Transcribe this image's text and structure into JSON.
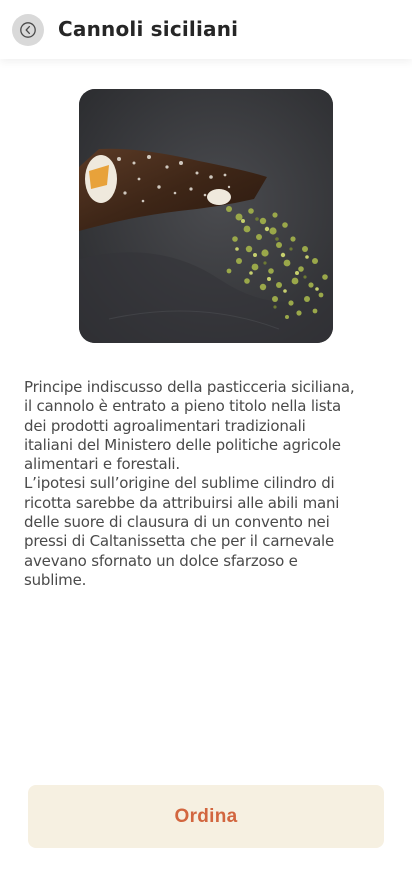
{
  "header": {
    "title": "Cannoli siciliani",
    "back_icon": "chevron-left-circle-icon"
  },
  "product": {
    "image_subject": "cannolo-with-pistachio"
  },
  "description": {
    "text": "Principe indiscusso della pasticceria siciliana,\nil cannolo è entrato a pieno titolo nella lista\ndei prodotti agroalimentari tradizionali\nitaliani del Ministero delle politiche agricole\nalimentari e forestali.\nL’ipotesi sull’origine del sublime cilindro di\nricotta sarebbe da attribuirsi alle abili mani\ndelle suore di clausura di un convento nei\npressi di Caltanissetta che per il carnevale\navevano sfornato un dolce sfarzoso e\nsublime."
  },
  "order_button": {
    "label": "Ordina"
  },
  "colors": {
    "accent": "#d2663f",
    "button_background": "#f6f0e1",
    "back_button_background": "#d9d9d9",
    "text": "#4a4a4a",
    "title": "#262626"
  }
}
